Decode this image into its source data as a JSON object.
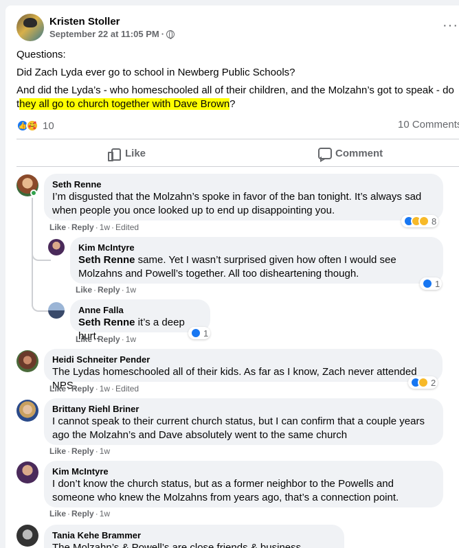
{
  "post": {
    "author": "Kristen Stoller",
    "timestamp": "September 22 at 11:05 PM",
    "separator": "·",
    "privacy_icon": "globe-icon",
    "more_icon": "···",
    "lines": {
      "l1": "Questions:",
      "l2": "Did Zach Lyda ever go to school in Newberg Public Schools?",
      "l3": "And did the Lyda’s - who homeschooled all of their children, and the Molzahn’s got to speak - do",
      "l4_pre": "t",
      "l4_hl": "hey all go to church together with Dave Brown",
      "l4_post": "?"
    },
    "reaction_count": "10",
    "comments_count": "10 Comments",
    "like_label": "Like",
    "comment_label": "Comment",
    "highlight_color": "#ffff00"
  },
  "comments": {
    "c1": {
      "name": "Seth Renne",
      "text": "I’m disgusted that the Molzahn’s spoke in favor of the ban tonight. It’s always sad when people you once looked up to end up disappointing you.",
      "like": "Like",
      "reply": "Reply",
      "time": "1w",
      "edited": "Edited",
      "dot": "·",
      "reactions": "8"
    },
    "r1": {
      "name": "Kim McIntyre",
      "mention": "Seth Renne",
      "text": " same. Yet I wasn’t surprised given how often I would see Molzahns and Powell’s together. All too disheartening though.",
      "like": "Like",
      "reply": "Reply",
      "time": "1w",
      "dot": "·",
      "reactions": "1"
    },
    "r2": {
      "name": "Anne Falla",
      "mention": "Seth Renne",
      "text": " it’s a deep hurt.",
      "like": "Like",
      "reply": "Reply",
      "time": "1w",
      "dot": "·",
      "reactions": "1"
    },
    "c2": {
      "name": "Heidi Schneiter Pender",
      "text": "The Lydas homeschooled all of their kids. As far as I know, Zach never attended NPS.",
      "like": "Like",
      "reply": "Reply",
      "time": "1w",
      "edited": "Edited",
      "dot": "·",
      "reactions": "2"
    },
    "c3": {
      "name": "Brittany Riehl Briner",
      "text": "I cannot speak to their current church status, but I can confirm that a couple years ago the Molzahn’s and Dave absolutely went to the same church",
      "like": "Like",
      "reply": "Reply",
      "time": "1w",
      "dot": "·"
    },
    "c4": {
      "name": "Kim McIntyre",
      "text": "I don’t know the church status, but as a former neighbor to the Powells and someone who knew the Molzahns from years ago, that’s a connection point.",
      "like": "Like",
      "reply": "Reply",
      "time": "1w",
      "dot": "·"
    },
    "c5": {
      "name": "Tania Kehe Brammer",
      "text": "The Molzahn’s & Powell’s are close friends & business partners."
    }
  },
  "colors": {
    "like_blue": "#1877f2",
    "emoji_yellow": "#f7b928",
    "meta_gray": "#65676b",
    "bubble_bg": "#f0f2f5"
  }
}
